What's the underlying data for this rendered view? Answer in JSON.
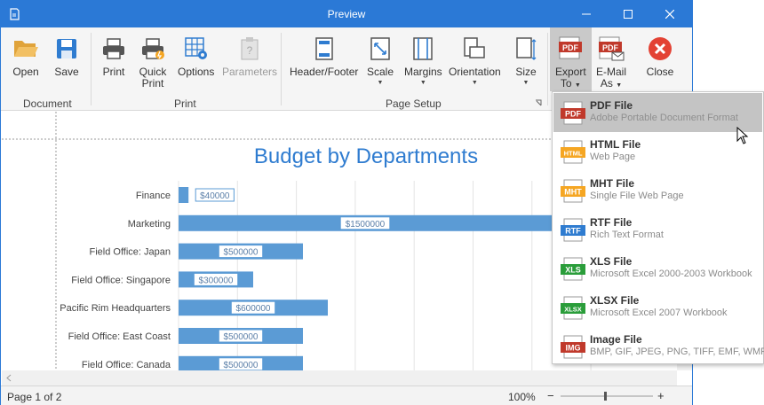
{
  "window": {
    "title": "Preview",
    "minimize_icon": "minimize-icon",
    "maximize_icon": "maximize-icon",
    "close_icon": "close-icon"
  },
  "ribbon": {
    "groups": {
      "document": "Document",
      "print": "Print",
      "page_setup": "Page Setup"
    },
    "buttons": {
      "open": "Open",
      "save": "Save",
      "print": "Print",
      "quick_print_1": "Quick",
      "quick_print_2": "Print",
      "options": "Options",
      "parameters": "Parameters",
      "header_footer": "Header/Footer",
      "scale": "Scale",
      "margins": "Margins",
      "orientation": "Orientation",
      "size": "Size",
      "export_1": "Export",
      "export_2": "To",
      "email_1": "E-Mail",
      "email_2": "As",
      "close": "Close"
    }
  },
  "export_menu": {
    "items": [
      {
        "icon_text": "PDF",
        "name": "PDF File",
        "desc": "Adobe Portable Document Format",
        "color": "#c0392b"
      },
      {
        "icon_text": "HTML",
        "name": "HTML File",
        "desc": "Web Page",
        "color": "#f5a623"
      },
      {
        "icon_text": "MHT",
        "name": "MHT File",
        "desc": "Single File Web Page",
        "color": "#f5a623"
      },
      {
        "icon_text": "RTF",
        "name": "RTF File",
        "desc": "Rich Text Format",
        "color": "#2f7cd0"
      },
      {
        "icon_text": "XLS",
        "name": "XLS File",
        "desc": "Microsoft Excel 2000-2003 Workbook",
        "color": "#2a9d3a"
      },
      {
        "icon_text": "XLSX",
        "name": "XLSX File",
        "desc": "Microsoft Excel 2007 Workbook",
        "color": "#2a9d3a"
      },
      {
        "icon_text": "IMG",
        "name": "Image File",
        "desc": "BMP, GIF, JPEG, PNG, TIFF, EMF, WMF",
        "color": "#c0392b"
      }
    ]
  },
  "status": {
    "page": "Page 1 of 2",
    "zoom": "100%",
    "minus": "−",
    "plus": "+"
  },
  "colors": {
    "accent": "#2b79d6",
    "bar": "#5b9bd5",
    "title": "#2f7cd0"
  },
  "chart_data": {
    "type": "bar",
    "orientation": "horizontal",
    "title": "Budget by Departments",
    "categories": [
      "Finance",
      "Marketing",
      "Field Office: Japan",
      "Field Office: Singapore",
      "Pacific Rim Headquarters",
      "Field Office: East Coast",
      "Field Office: Canada"
    ],
    "values": [
      40000,
      1500000,
      500000,
      300000,
      600000,
      500000,
      500000
    ],
    "labels": [
      "$40000",
      "$1500000",
      "$500000",
      "$300000",
      "$600000",
      "$500000",
      "$500000"
    ],
    "grid": true
  }
}
